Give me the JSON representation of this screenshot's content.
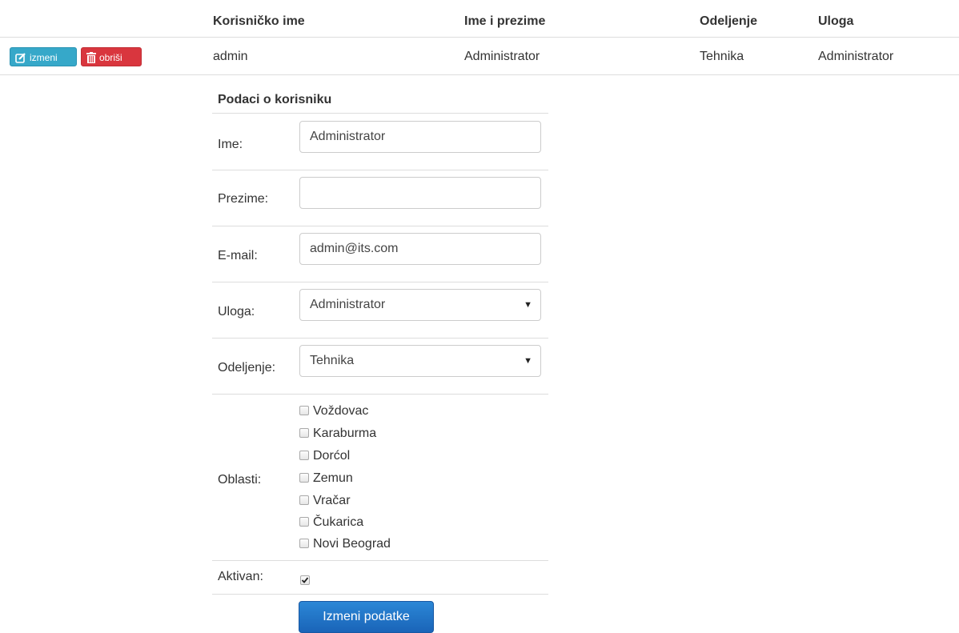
{
  "table": {
    "headers": [
      "Korisničko ime",
      "Ime i prezime",
      "Odeljenje",
      "Uloga"
    ],
    "row": {
      "username": "admin",
      "full_name": "Administrator",
      "department": "Tehnika",
      "role": "Administrator",
      "edit_label": "izmeni",
      "delete_label": "obriši"
    }
  },
  "form": {
    "title": "Podaci o korisniku",
    "first_name": {
      "label": "Ime:",
      "value": "Administrator"
    },
    "last_name": {
      "label": "Prezime:",
      "value": ""
    },
    "email": {
      "label": "E-mail:",
      "value": "admin@its.com"
    },
    "role": {
      "label": "Uloga:",
      "value": "Administrator"
    },
    "department": {
      "label": "Odeljenje:",
      "value": "Tehnika"
    },
    "areas": {
      "label": "Oblasti:",
      "items": [
        "Voždovac",
        "Karaburma",
        "Dorćol",
        "Zemun",
        "Vračar",
        "Čukarica",
        "Novi Beograd"
      ]
    },
    "active": {
      "label": "Aktivan:",
      "checked": true
    },
    "submit_label": "Izmeni podatke"
  },
  "colors": {
    "edit_button": "#36a8c9",
    "delete_button": "#d9363e",
    "submit_button": "#1f6fc5"
  }
}
